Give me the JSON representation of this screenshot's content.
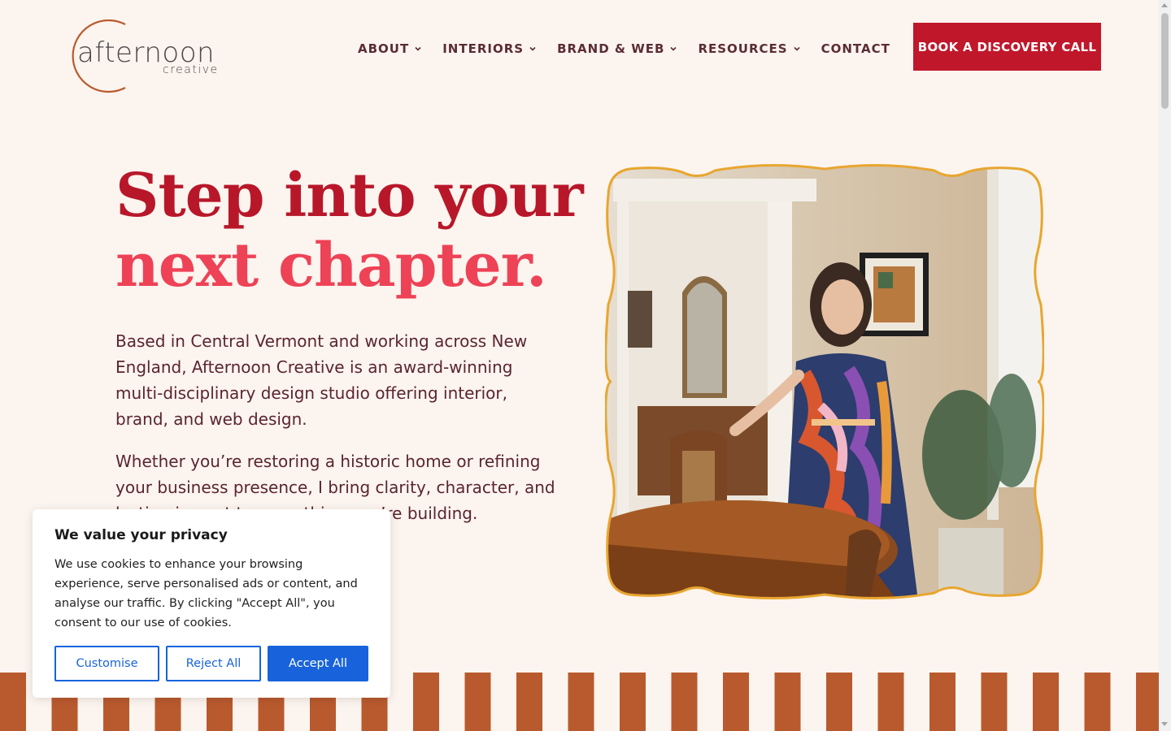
{
  "logo": {
    "word": "afternoon",
    "sub": "creative",
    "color": "#b95a2e"
  },
  "nav": {
    "items": [
      {
        "label": "ABOUT",
        "has_dropdown": true
      },
      {
        "label": "INTERIORS",
        "has_dropdown": true
      },
      {
        "label": "BRAND & WEB",
        "has_dropdown": true
      },
      {
        "label": "RESOURCES",
        "has_dropdown": true
      },
      {
        "label": "CONTACT",
        "has_dropdown": false
      }
    ],
    "cta_label": "BOOK A DISCOVERY CALL"
  },
  "hero": {
    "title_line1": "Step into your",
    "title_line2": "next chapter.",
    "paragraph1": "Based in Central Vermont and working across New England, Afternoon Creative is an award-winning multi-disciplinary design studio offering interior, brand, and web design.",
    "paragraph2": "Whether you’re restoring a historic home or refining your business presence, I bring clarity, character, and",
    "paragraph2_partial": "lasting impact to everything you’re building.",
    "photo_alt": "woman in colorful dress standing in dining room"
  },
  "cookie_banner": {
    "title": "We value your privacy",
    "text": "We use cookies to enhance your browsing experience, serve personalised ads or content, and analyse our traffic. By clicking \"Accept All\", you consent to our use of cookies.",
    "customise_label": "Customise",
    "reject_label": "Reject All",
    "accept_label": "Accept All"
  },
  "colors": {
    "background": "#fcf4ee",
    "brand_red": "#c0172b",
    "title_red": "#b8172a",
    "title_pink": "#ee4256",
    "text_maroon": "#5a2530",
    "stripe_rust": "#b95a2e",
    "photo_frame": "#e8a630",
    "cookie_blue": "#1863dc"
  }
}
